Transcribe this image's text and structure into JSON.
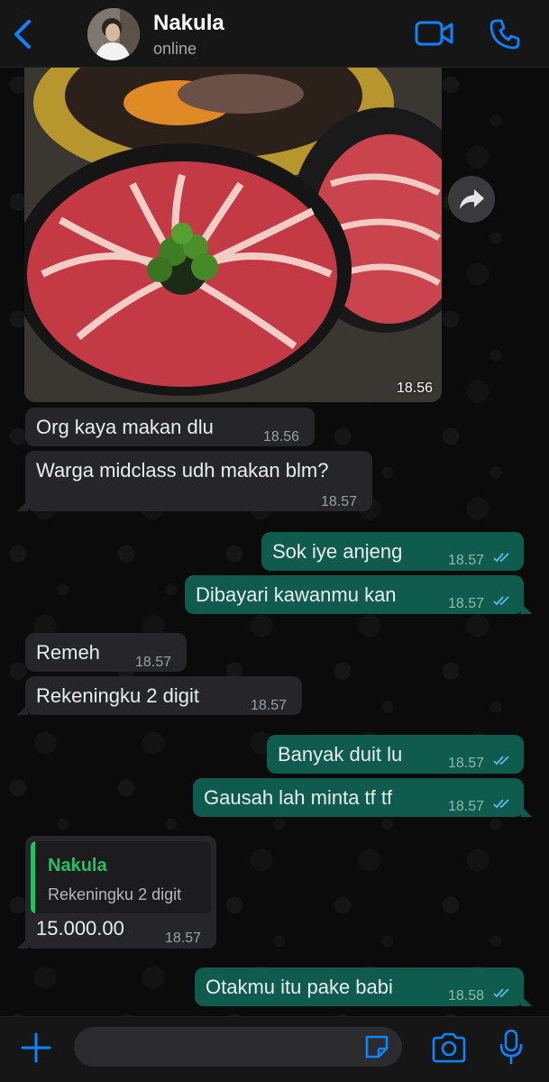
{
  "header": {
    "contact_name": "Nakula",
    "status": "online",
    "back_icon": "chevron-left-icon",
    "video_icon": "video-camera-icon",
    "call_icon": "phone-icon"
  },
  "messages": [
    {
      "type": "image",
      "direction": "in",
      "time": "18.56"
    },
    {
      "type": "text",
      "direction": "in",
      "text": "Org kaya makan dlu",
      "time": "18.56"
    },
    {
      "type": "text",
      "direction": "in",
      "text": "Warga midclass udh makan blm?",
      "time": "18.57"
    },
    {
      "type": "text",
      "direction": "out",
      "text": "Sok iye anjeng",
      "time": "18.57",
      "status": "read"
    },
    {
      "type": "text",
      "direction": "out",
      "text": "Dibayari kawanmu kan",
      "time": "18.57",
      "status": "read"
    },
    {
      "type": "text",
      "direction": "in",
      "text": "Remeh",
      "time": "18.57"
    },
    {
      "type": "text",
      "direction": "in",
      "text": "Rekeningku 2 digit",
      "time": "18.57"
    },
    {
      "type": "text",
      "direction": "out",
      "text": "Banyak duit lu",
      "time": "18.57",
      "status": "read"
    },
    {
      "type": "text",
      "direction": "out",
      "text": "Gausah lah minta tf tf",
      "time": "18.57",
      "status": "read"
    },
    {
      "type": "reply",
      "direction": "in",
      "quoted_name": "Nakula",
      "quoted_text": "Rekeningku 2 digit",
      "text": "15.000.00",
      "time": "18.57"
    },
    {
      "type": "text",
      "direction": "out",
      "text": "Otakmu itu pake babi",
      "time": "18.58",
      "status": "read"
    }
  ],
  "input_bar": {
    "placeholder": "",
    "plus_icon": "plus-icon",
    "sticker_icon": "sticker-icon",
    "camera_icon": "camera-icon",
    "mic_icon": "microphone-icon"
  },
  "colors": {
    "accent": "#0a84ff",
    "outgoing_bubble": "#0f5b4d",
    "incoming_bubble": "#262628",
    "read_ticks": "#53bdeb",
    "reply_name": "#21c063"
  }
}
